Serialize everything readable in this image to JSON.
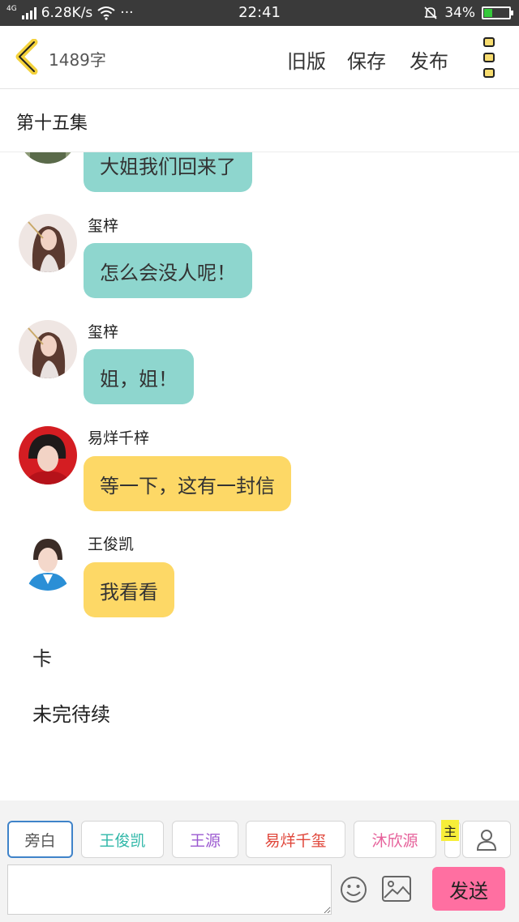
{
  "status_bar": {
    "network": "4G",
    "speed": "6.28K/s",
    "more": "···",
    "time": "22:41",
    "battery": "34%",
    "battery_level": 0.34
  },
  "header": {
    "word_count": "1489字",
    "old_version": "旧版",
    "save": "保存",
    "publish": "发布"
  },
  "chapter": {
    "title": "第十五集"
  },
  "messages": [
    {
      "speaker": "",
      "text": "大姐我们回来了",
      "style": "teal",
      "partial": true
    },
    {
      "speaker": "玺梓",
      "text": "怎么会没人呢！",
      "style": "teal"
    },
    {
      "speaker": "玺梓",
      "text": "姐，姐！",
      "style": "teal"
    },
    {
      "speaker": "易烊千梓",
      "text": "等一下，这有一封信",
      "style": "yellow"
    },
    {
      "speaker": "王俊凯",
      "text": "我看看",
      "style": "yellow"
    }
  ],
  "narration": [
    "卡",
    "未完待续"
  ],
  "roles": [
    {
      "label": "旁白",
      "color": "#555555"
    },
    {
      "label": "王俊凯",
      "color": "#2fb7a8"
    },
    {
      "label": "王源",
      "color": "#9b59d0"
    },
    {
      "label": "易烊千玺",
      "color": "#e0463a"
    },
    {
      "label": "沐欣源",
      "color": "#e6609a"
    }
  ],
  "role_tag": "主",
  "input": {
    "value": "",
    "placeholder": ""
  },
  "send_label": "发送"
}
